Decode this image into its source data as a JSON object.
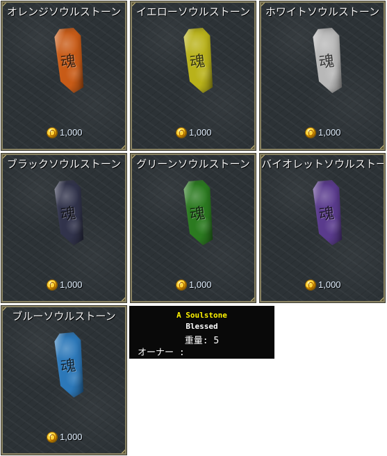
{
  "items": [
    {
      "name": "オレンジソウルストーン",
      "price": "1,000",
      "stone_color": "#c85b17"
    },
    {
      "name": "イエローソウルストーン",
      "price": "1,000",
      "stone_color": "#b9b21a"
    },
    {
      "name": "ホワイトソウルストーン",
      "price": "1,000",
      "stone_color": "#b8b8b8"
    },
    {
      "name": "ブラックソウルストーン",
      "price": "1,000",
      "stone_color": "#31334b"
    },
    {
      "name": "グリーンソウルストーン",
      "price": "1,000",
      "stone_color": "#2b7a20"
    },
    {
      "name": "バイオレットソウルストーン",
      "price": "1,000",
      "stone_color": "#5a3b8d"
    },
    {
      "name": "ブルーソウルストーン",
      "price": "1,000",
      "stone_color": "#2c78b9"
    }
  ],
  "tooltip": {
    "title": "A Soulstone",
    "blessed": "Blessed",
    "weight": "重量: 5",
    "owner": "オーナー :"
  },
  "icons": {
    "price": "coin-icon",
    "item": "soulstone-icon"
  }
}
